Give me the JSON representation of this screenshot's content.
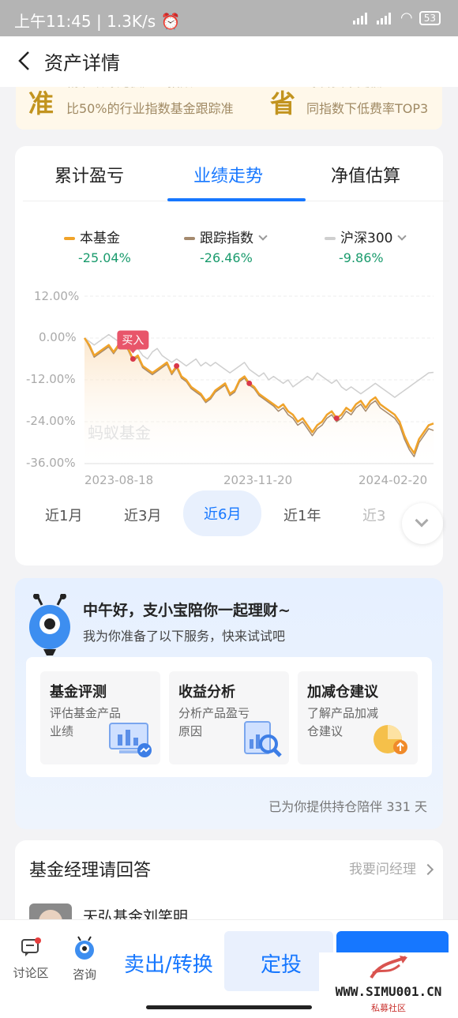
{
  "status": {
    "time": "上午11:45",
    "speed": "1.3K/s",
    "battery": "53"
  },
  "nav": {
    "title": "资产详情"
  },
  "banner": {
    "left": {
      "title": "精准跟踪光伏产业指数",
      "desc": "比50%的行业指数基金跟踪准",
      "icon": "准"
    },
    "right": {
      "title": "综合费率更低",
      "desc": "同指数下低费率TOP3",
      "icon": "省"
    }
  },
  "tabs": [
    "累计盈亏",
    "业绩走势",
    "净值估算"
  ],
  "legend": [
    {
      "name": "本基金",
      "value": "-25.04%",
      "color": "#f0a32a"
    },
    {
      "name": "跟踪指数",
      "value": "-26.46%",
      "color": "#a58a6e"
    },
    {
      "name": "沪深300",
      "value": "-9.86%",
      "color": "#cfcfcf"
    }
  ],
  "chart_data": {
    "type": "line",
    "y_ticks": [
      "12.00%",
      "0.00%",
      "-12.00%",
      "-24.00%",
      "-36.00%"
    ],
    "ylim": [
      -36,
      12
    ],
    "x_ticks": [
      "2023-08-18",
      "2023-11-20",
      "2024-02-20"
    ],
    "watermark": "蚂蚁基金",
    "buy_label": "买入",
    "series": [
      {
        "name": "本基金",
        "color": "#f0a32a",
        "values": [
          0,
          -2,
          -5,
          -4,
          -3,
          -2,
          -4,
          -2,
          -1,
          -3,
          -6,
          -5,
          -8,
          -9,
          -10,
          -9,
          -8,
          -7,
          -10,
          -8,
          -11,
          -12,
          -14,
          -15,
          -16,
          -18,
          -17,
          -15,
          -14,
          -13,
          -16,
          -15,
          -12,
          -11,
          -13,
          -14,
          -16,
          -17,
          -18,
          -19,
          -20,
          -19,
          -21,
          -22,
          -24,
          -23,
          -25,
          -27,
          -25,
          -24,
          -22,
          -21,
          -23,
          -22,
          -20,
          -21,
          -19,
          -18,
          -20,
          -18,
          -17,
          -19,
          -20,
          -21,
          -22,
          -24,
          -28,
          -31,
          -33,
          -29,
          -27,
          -25,
          -24.5
        ]
      },
      {
        "name": "跟踪指数",
        "color": "#a58a6e",
        "values": [
          0,
          -2.5,
          -5.5,
          -4.5,
          -3.5,
          -2.5,
          -4.5,
          -2.5,
          -1.5,
          -3.5,
          -6.5,
          -5.5,
          -8.5,
          -9.5,
          -10.5,
          -9.5,
          -8.5,
          -7.5,
          -10.5,
          -8.5,
          -11.5,
          -12.5,
          -14.5,
          -15.5,
          -16.5,
          -18.5,
          -17.5,
          -15.5,
          -14.5,
          -13.5,
          -16.5,
          -15.5,
          -12.5,
          -11.5,
          -13.5,
          -14.5,
          -16.5,
          -17.5,
          -18.5,
          -19.5,
          -21,
          -20,
          -22,
          -23,
          -25,
          -24,
          -26,
          -28,
          -26,
          -25,
          -23,
          -22,
          -24,
          -23,
          -21,
          -22,
          -20,
          -19,
          -21,
          -19,
          -18,
          -20,
          -21,
          -22,
          -23,
          -25,
          -29,
          -32,
          -34,
          -30,
          -28,
          -26,
          -26.5
        ]
      },
      {
        "name": "沪深300",
        "color": "#cfcfcf",
        "values": [
          0,
          -1,
          -2,
          -1,
          0,
          1,
          0,
          -1,
          -2,
          -3,
          -4,
          -3,
          -5,
          -6,
          -4,
          -3,
          -5,
          -6,
          -7,
          -6,
          -7,
          -8,
          -7,
          -6,
          -8,
          -7,
          -8,
          -7,
          -8,
          -9,
          -10,
          -9,
          -8,
          -7,
          -9,
          -10,
          -11,
          -10,
          -12,
          -11,
          -12,
          -13,
          -12,
          -14,
          -13,
          -12,
          -11,
          -12,
          -10,
          -11,
          -12,
          -13,
          -12,
          -14,
          -15,
          -14,
          -15,
          -16,
          -15,
          -14,
          -13,
          -14,
          -15,
          -16,
          -17,
          -16,
          -15,
          -14,
          -13,
          -12,
          -11,
          -10,
          -9.86
        ]
      }
    ],
    "buy_index": 10,
    "markers": [
      10,
      19,
      34,
      52
    ]
  },
  "periods": [
    "近1月",
    "近3月",
    "近6月",
    "近1年",
    "近3"
  ],
  "active_period": "近6月",
  "assistant": {
    "greeting": "中午好，支小宝陪你一起理财~",
    "sub": "我为你准备了以下服务，快来试试吧",
    "services": [
      {
        "title": "基金评测",
        "desc": "评估基金产品业绩"
      },
      {
        "title": "收益分析",
        "desc": "分析产品盈亏原因"
      },
      {
        "title": "加减仓建议",
        "desc": "了解产品加减仓建议"
      }
    ],
    "footer": "已为你提供持仓陪伴 331 天"
  },
  "manager": {
    "title": "基金经理请回答",
    "ask": "我要问经理",
    "name": "天弘基金刘笑明"
  },
  "bottom": {
    "discuss": "讨论区",
    "consult": "咨询",
    "sell": "卖出/转换",
    "invest": "定投"
  },
  "watermark": {
    "site": "WWW.SIMU001.CN",
    "sub": "私募社区"
  }
}
